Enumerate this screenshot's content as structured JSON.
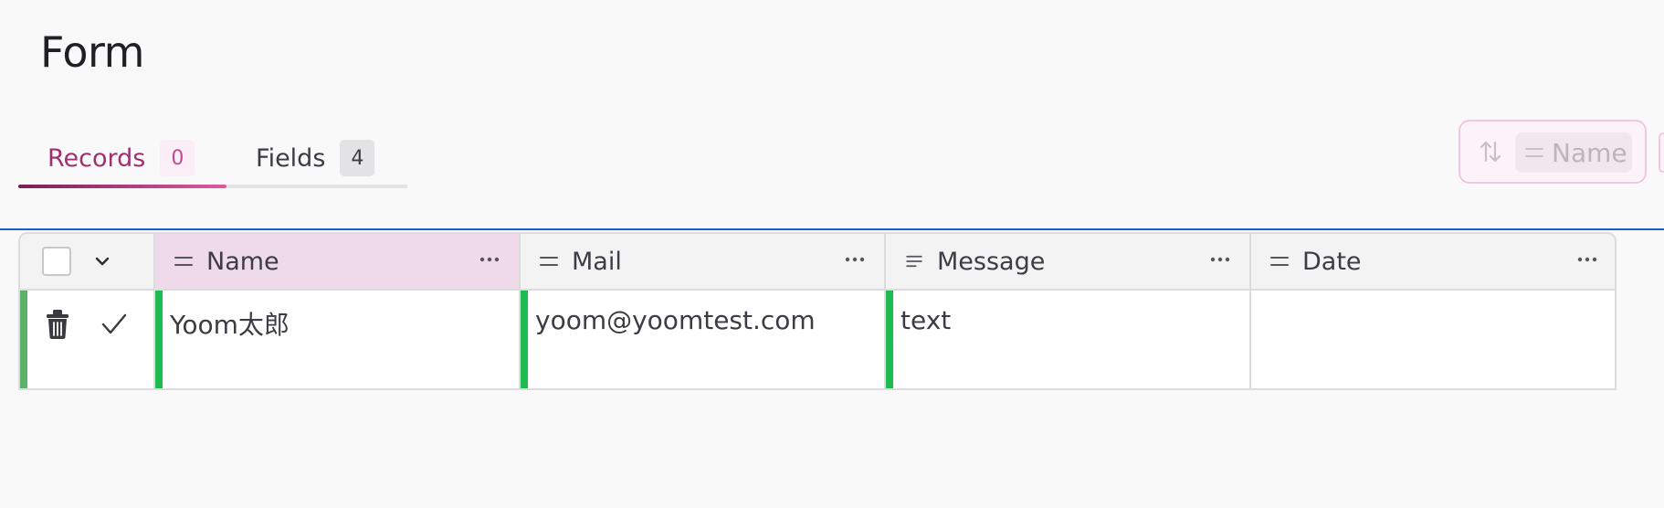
{
  "page": {
    "title": "Form"
  },
  "tabs": [
    {
      "label": "Records",
      "count": "0",
      "active": true
    },
    {
      "label": "Fields",
      "count": "4",
      "active": false
    }
  ],
  "sort": {
    "icon": "sort-arrows-icon",
    "field_icon": "equals-lines-icon",
    "field": "Name"
  },
  "colors": {
    "accent": "#a0306f",
    "row_status_green": "#1fbb4f",
    "selected_header": "#efdae9",
    "focus_line": "#1a5fd0"
  },
  "table": {
    "columns": [
      {
        "label": "Name",
        "icon": "equals-lines-icon",
        "selected": true
      },
      {
        "label": "Mail",
        "icon": "equals-lines-icon",
        "selected": false
      },
      {
        "label": "Message",
        "icon": "text-lines-icon",
        "selected": false
      },
      {
        "label": "Date",
        "icon": "equals-lines-icon",
        "selected": false
      }
    ],
    "rows": [
      {
        "cells": [
          "Yoom太郎",
          "yoom@yoomtest.com",
          "text",
          ""
        ]
      }
    ],
    "row_icons": [
      "trash-icon",
      "check-icon"
    ],
    "column_menu_icon": "more-horizontal-icon",
    "select_all_icon": "chevron-down-icon"
  }
}
